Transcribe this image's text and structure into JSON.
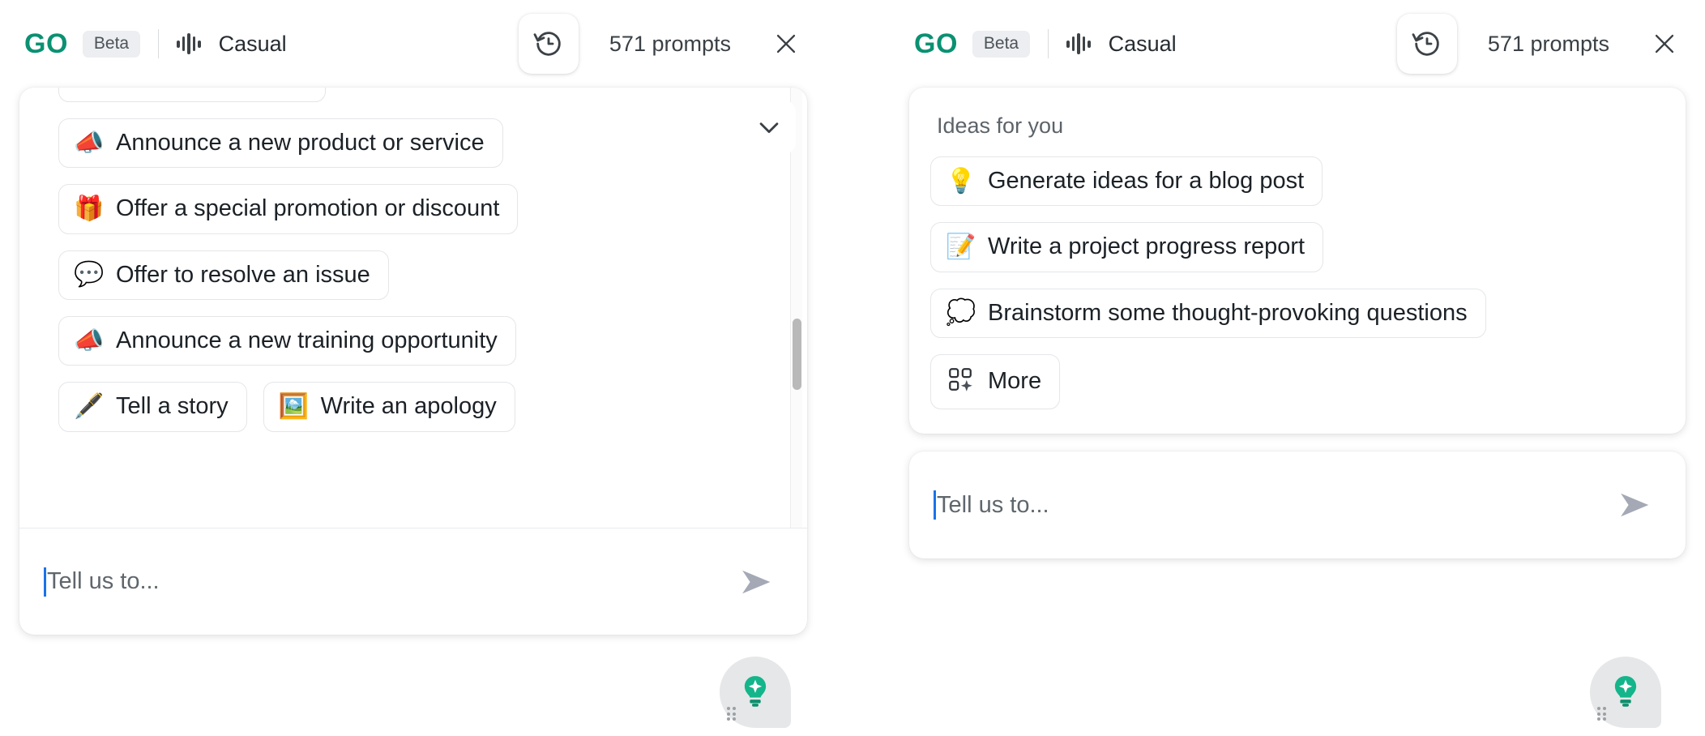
{
  "header": {
    "logo_text": "GO",
    "beta_label": "Beta",
    "wave_icon": "waveform-icon",
    "tone_label": "Casual",
    "history_icon": "history-clock-icon",
    "prompt_count": "571 prompts",
    "close_icon": "close-icon"
  },
  "colors": {
    "brand_green": "#0a9172",
    "fab_green": "#14b58a",
    "caret_blue": "#1a73e8",
    "chip_border": "#e4e6e9",
    "badge_bg": "#eceef1",
    "text_primary": "#1b2126",
    "text_secondary": "#5c6369",
    "send_gray": "#a4a9b5",
    "scrollbar_thumb": "#b9b9b9"
  },
  "left_panel": {
    "collapse_icon": "chevron-down-icon",
    "scrollbar": {
      "icon": "scrollbar-thumb",
      "position_percent": 62
    },
    "chips": [
      {
        "emoji": "📣",
        "icon": "megaphone-icon",
        "label": "Announce a new product or service"
      },
      {
        "emoji": "🎁",
        "icon": "gift-icon",
        "label": "Offer a special promotion or discount"
      },
      {
        "emoji": "💬",
        "icon": "speech-bubble-check-icon",
        "label": "Offer to resolve an issue"
      },
      {
        "emoji": "📣",
        "icon": "megaphone-icon",
        "label": "Announce a new training opportunity"
      },
      {
        "emoji": "🖋️",
        "icon": "quill-pen-icon",
        "label": "Tell a story"
      },
      {
        "emoji": "🖼️",
        "icon": "framed-picture-icon",
        "label": "Write an apology"
      }
    ],
    "composer": {
      "placeholder": "Tell us to...",
      "value": "",
      "send_icon": "send-arrow-icon"
    }
  },
  "right_panel": {
    "section_title": "Ideas for you",
    "chips": [
      {
        "emoji": "💡",
        "icon": "lightbulb-icon",
        "label": "Generate ideas for a blog post"
      },
      {
        "emoji": "📝",
        "icon": "memo-icon",
        "label": "Write a project progress report"
      },
      {
        "emoji": "💭",
        "icon": "thought-bolt-icon",
        "label": "Brainstorm some thought-provoking questions"
      }
    ],
    "more_button": {
      "label": "More",
      "icon": "grid-sparkle-icon"
    },
    "composer": {
      "placeholder": "Tell us to...",
      "value": "",
      "send_icon": "send-arrow-icon"
    }
  },
  "fab": {
    "icon": "lightbulb-sparkle-icon",
    "grip_icon": "drag-grip-icon"
  }
}
